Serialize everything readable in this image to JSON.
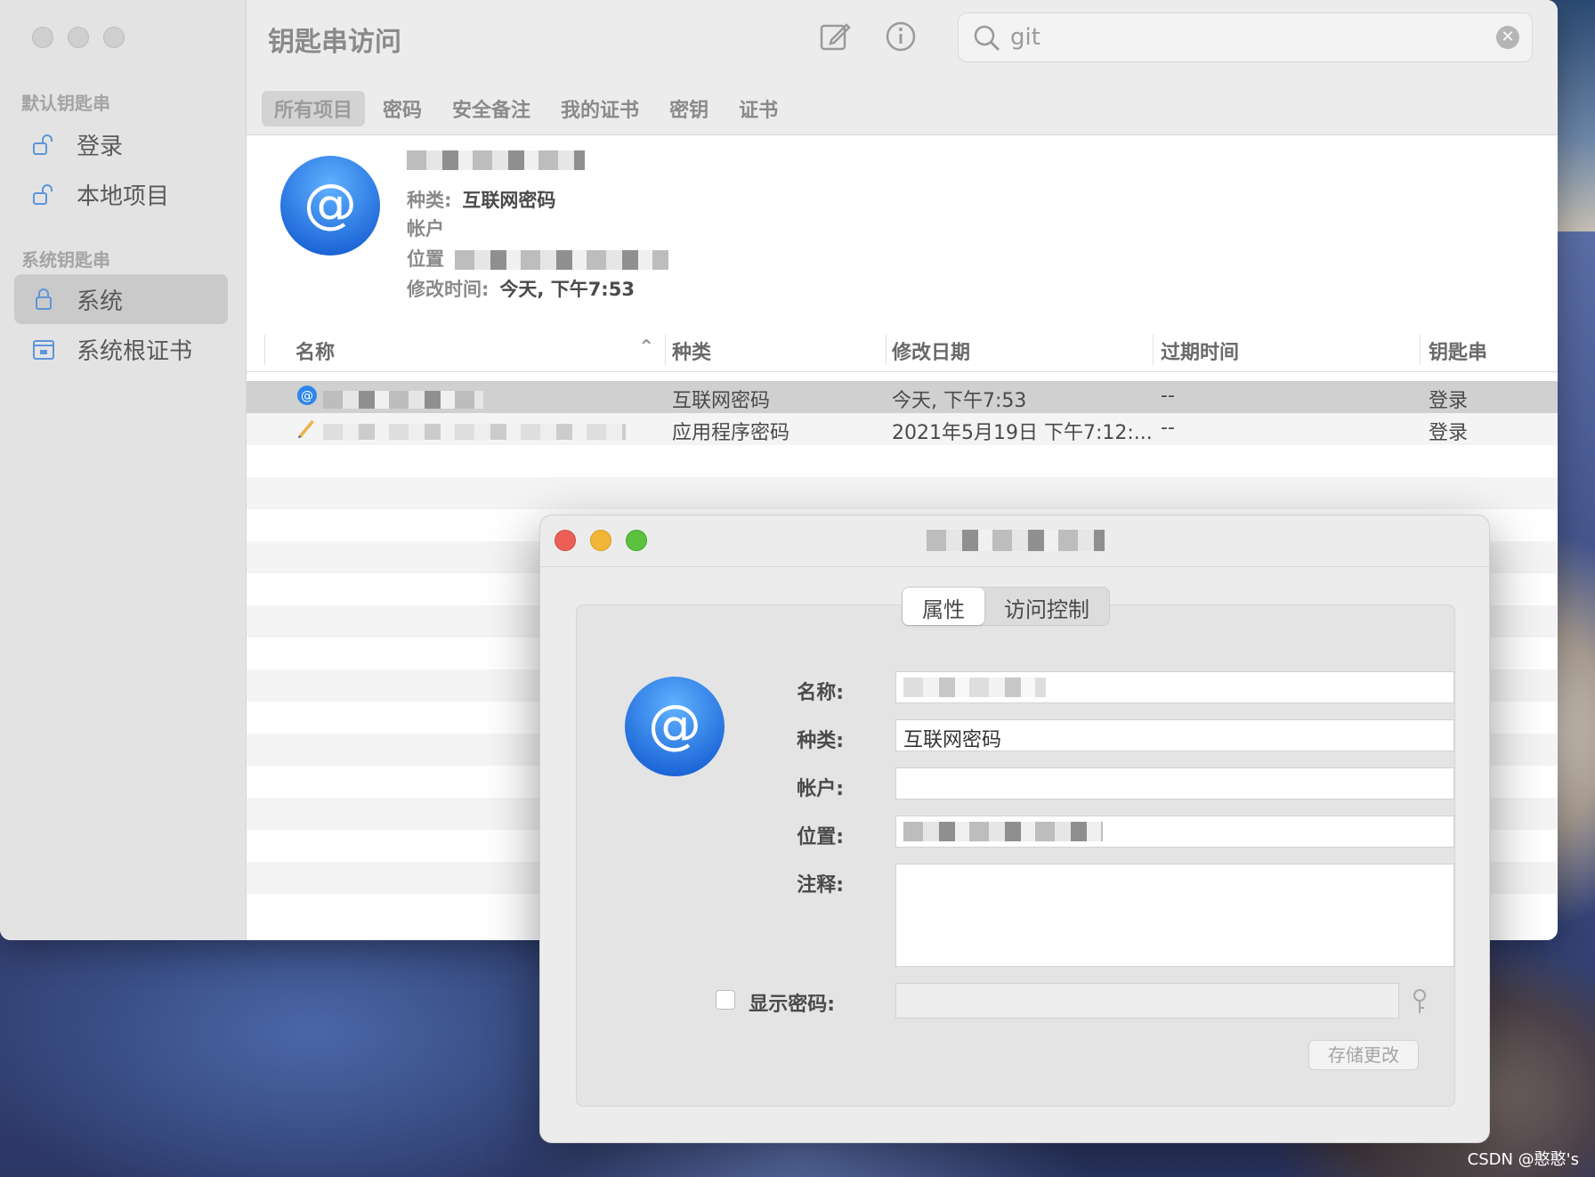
{
  "window": {
    "title": "钥匙串访问"
  },
  "sidebar": {
    "default_section": "默认钥匙串",
    "system_section": "系统钥匙串",
    "items": [
      {
        "label": "登录"
      },
      {
        "label": "本地项目"
      },
      {
        "label": "系统"
      },
      {
        "label": "系统根证书"
      }
    ]
  },
  "search": {
    "value": "git"
  },
  "tabs": [
    "所有项目",
    "密码",
    "安全备注",
    "我的证书",
    "密钥",
    "证书"
  ],
  "detail": {
    "kind_label": "种类:",
    "kind_value": "互联网密码",
    "account_label": "帐户",
    "location_label": "位置",
    "modified_label": "修改时间:",
    "modified_value": "今天, 下午7:53"
  },
  "table": {
    "columns": [
      "名称",
      "种类",
      "修改日期",
      "过期时间",
      "钥匙串"
    ],
    "rows": [
      {
        "kind": "互联网密码",
        "date": "今天, 下午7:53",
        "expires": "--",
        "keychain": "登录"
      },
      {
        "kind": "应用程序密码",
        "date": "2021年5月19日 下午7:12:...",
        "expires": "--",
        "keychain": "登录"
      }
    ]
  },
  "dialog": {
    "tabs": [
      "属性",
      "访问控制"
    ],
    "labels": {
      "name": "名称:",
      "kind": "种类:",
      "account": "帐户:",
      "location": "位置:",
      "comment": "注释:",
      "show_password": "显示密码:"
    },
    "kind_value": "互联网密码",
    "save_label": "存储更改"
  },
  "watermark": "CSDN @憨憨's",
  "colors": {
    "close": "#ec5f56",
    "minimize": "#f2b535",
    "zoom": "#5bc13e",
    "at_icon": "#2d86ec"
  }
}
